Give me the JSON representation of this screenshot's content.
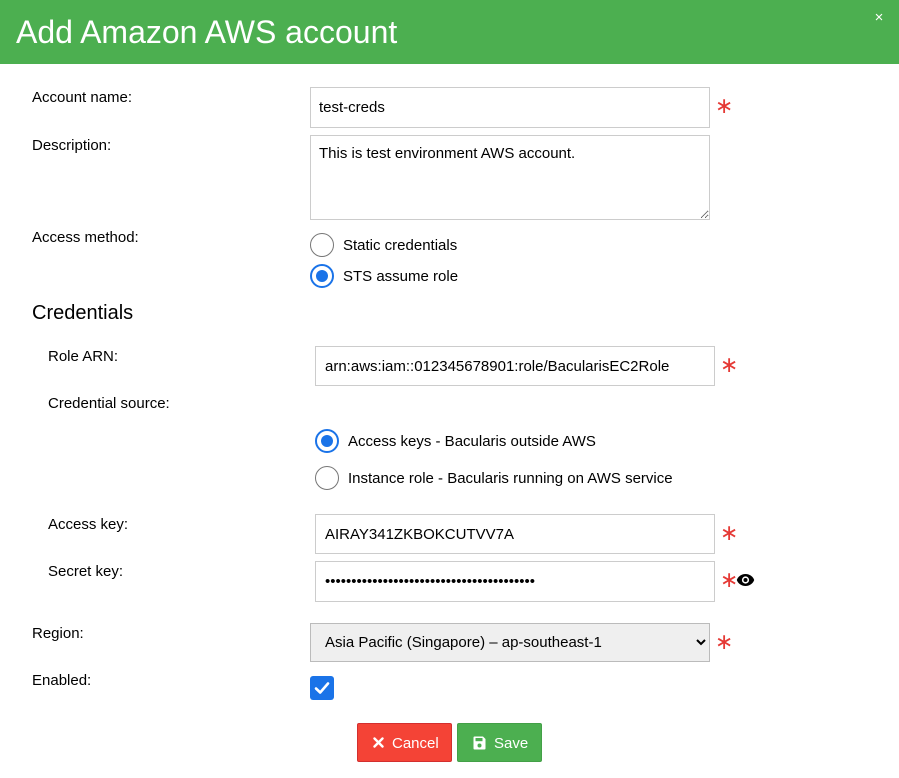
{
  "dialog": {
    "title": "Add Amazon AWS account",
    "close_glyph": "×"
  },
  "form": {
    "account_name": {
      "label": "Account name:",
      "value": "test-creds"
    },
    "description": {
      "label": "Description:",
      "value": "This is test environment AWS account."
    },
    "access_method": {
      "label": "Access method:",
      "options": [
        {
          "label": "Static credentials",
          "selected": false
        },
        {
          "label": "STS assume role",
          "selected": true
        }
      ]
    },
    "required_marker": "∗"
  },
  "credentials": {
    "section_title": "Credentials",
    "role_arn": {
      "label": "Role ARN:",
      "value": "arn:aws:iam::012345678901:role/BacularisEC2Role"
    },
    "credential_source": {
      "label": "Credential source:",
      "options": [
        {
          "label": "Access keys - Bacularis outside AWS",
          "selected": true
        },
        {
          "label": "Instance role - Bacularis running on AWS service",
          "selected": false
        }
      ]
    },
    "access_key": {
      "label": "Access key:",
      "value": "AIRAY341ZKBOKCUTVV7A"
    },
    "secret_key": {
      "label": "Secret key:",
      "value": "••••••••••••••••••••••••••••••••••••••••"
    }
  },
  "region": {
    "label": "Region:",
    "selected": "Asia Pacific (Singapore) – ap-southeast-1"
  },
  "enabled": {
    "label": "Enabled:",
    "checked": true
  },
  "buttons": {
    "cancel_label": "Cancel",
    "save_label": "Save"
  },
  "icons": {
    "close": "close-icon",
    "eye": "eye-icon",
    "cancel": "times-icon",
    "save": "floppy-disk-icon",
    "required": "asterisk-icon"
  },
  "colors": {
    "header": "#4caf50",
    "required": "#e53935",
    "accent": "#1a73e8",
    "cancel": "#f44336",
    "save": "#4caf50"
  }
}
